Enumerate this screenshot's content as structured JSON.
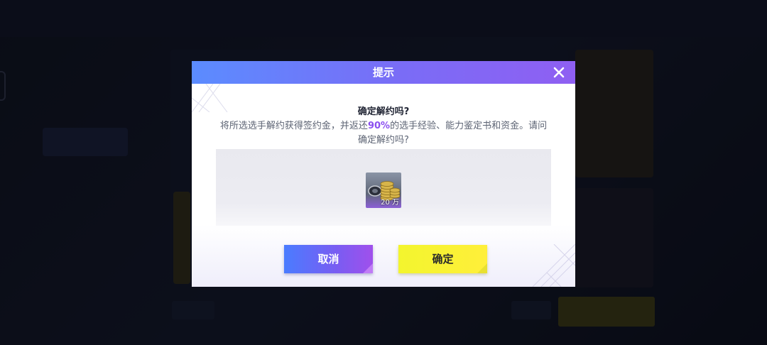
{
  "dialog": {
    "title": "提示",
    "heading": "确定解约吗?",
    "message_before": "将所选选手解约获得签约金，并返还",
    "message_highlight": "90%",
    "message_after": "的选手经验、能力鉴定书和资金。请问确定解约吗?",
    "reward": {
      "icon": "gold-coins-icon",
      "amount": "20 万"
    },
    "cancel_label": "取消",
    "confirm_label": "确定"
  },
  "colors": {
    "header_gradient_start": "#5b8cff",
    "header_gradient_end": "#8f5ff2",
    "highlight": "#8b4ff0",
    "cancel_button": "#6a6cf6",
    "confirm_button": "#f3f52e"
  }
}
